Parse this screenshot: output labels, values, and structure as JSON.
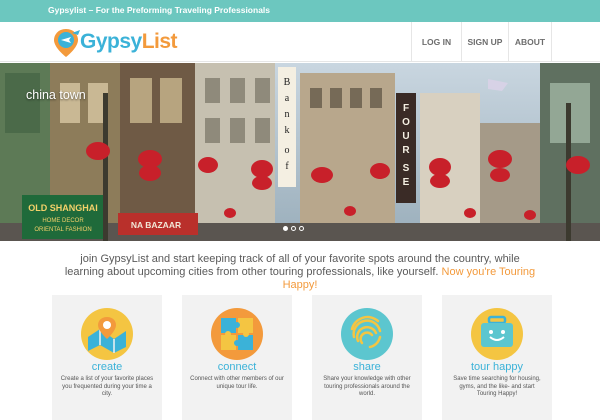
{
  "topbar": {
    "tagline": "Gypsylist – For the Preforming Traveling Professionals"
  },
  "header": {
    "logo": {
      "part1": "Gypsy",
      "part2": "List"
    },
    "nav": [
      {
        "label": "LOG IN"
      },
      {
        "label": "SIGN UP"
      },
      {
        "label": "ABOUT"
      }
    ]
  },
  "hero": {
    "caption": "china town",
    "signs": {
      "vertical_left": "Bank of",
      "vertical_right": "FOUR SEAS",
      "shop": "OLD SHANGHAI",
      "shop_sub1": "HOME DECOR",
      "shop_sub2": "ORIENTAL FASHION",
      "bazaar": "NA BAZAAR"
    },
    "slides": {
      "count": 3,
      "active": 1
    }
  },
  "intro": {
    "text": "join GypsyList and start keeping track of all of your favorite spots around the country, while learning about upcoming cities from other touring professionals, like yourself.",
    "highlight": "Now you're Touring Happy!"
  },
  "features": [
    {
      "title": "create",
      "desc": "Create a list of your favorite places you frequented during your time a city.",
      "icon": "map-pin-icon"
    },
    {
      "title": "connect",
      "desc": "Connect with other members of our unique tour life.",
      "icon": "puzzle-icon"
    },
    {
      "title": "share",
      "desc": "Share your knowledge with other touring professionals around the world.",
      "icon": "fingerprint-icon"
    },
    {
      "title": "tour happy",
      "desc": "Save time searching for housing, gyms, and the like- and start Touring Happy!",
      "icon": "happy-suitcase-icon"
    }
  ],
  "colors": {
    "teal": "#6cc7bf",
    "blue": "#3bb2d8",
    "orange": "#f39a3c",
    "card_bg": "#f2f2f2"
  }
}
